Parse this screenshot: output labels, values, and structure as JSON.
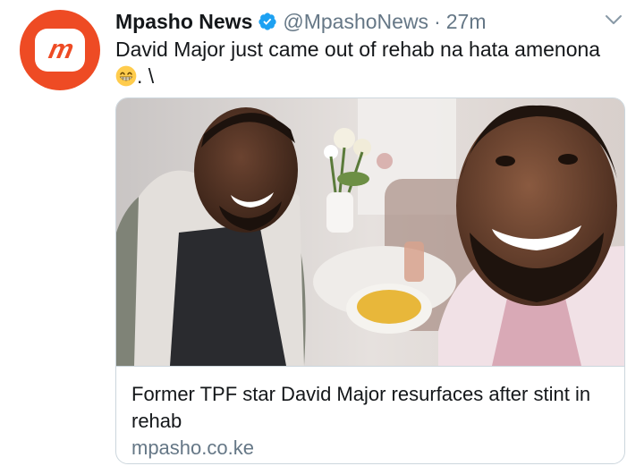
{
  "tweet": {
    "author": {
      "display_name": "Mpasho News",
      "handle": "@MpashoNews",
      "verified": true,
      "avatar_text": "m",
      "avatar_color": "#ee4b24"
    },
    "separator": "·",
    "time": "27m",
    "text_line1": "David Major just came out of rehab na hata amenona",
    "text_line2": ". \\",
    "emoji": "grinning-face-with-smiling-eyes",
    "card": {
      "image_alt": "Two smiling men taking a selfie in a lounge with flowers and a plate of food",
      "title": "Former TPF star David Major resurfaces after stint in rehab",
      "domain": "mpasho.co.ke"
    }
  },
  "colors": {
    "text_primary": "#14171a",
    "text_secondary": "#657786",
    "verified_blue": "#1da1f2",
    "border": "#ccd6dd",
    "brand": "#ee4b24"
  }
}
